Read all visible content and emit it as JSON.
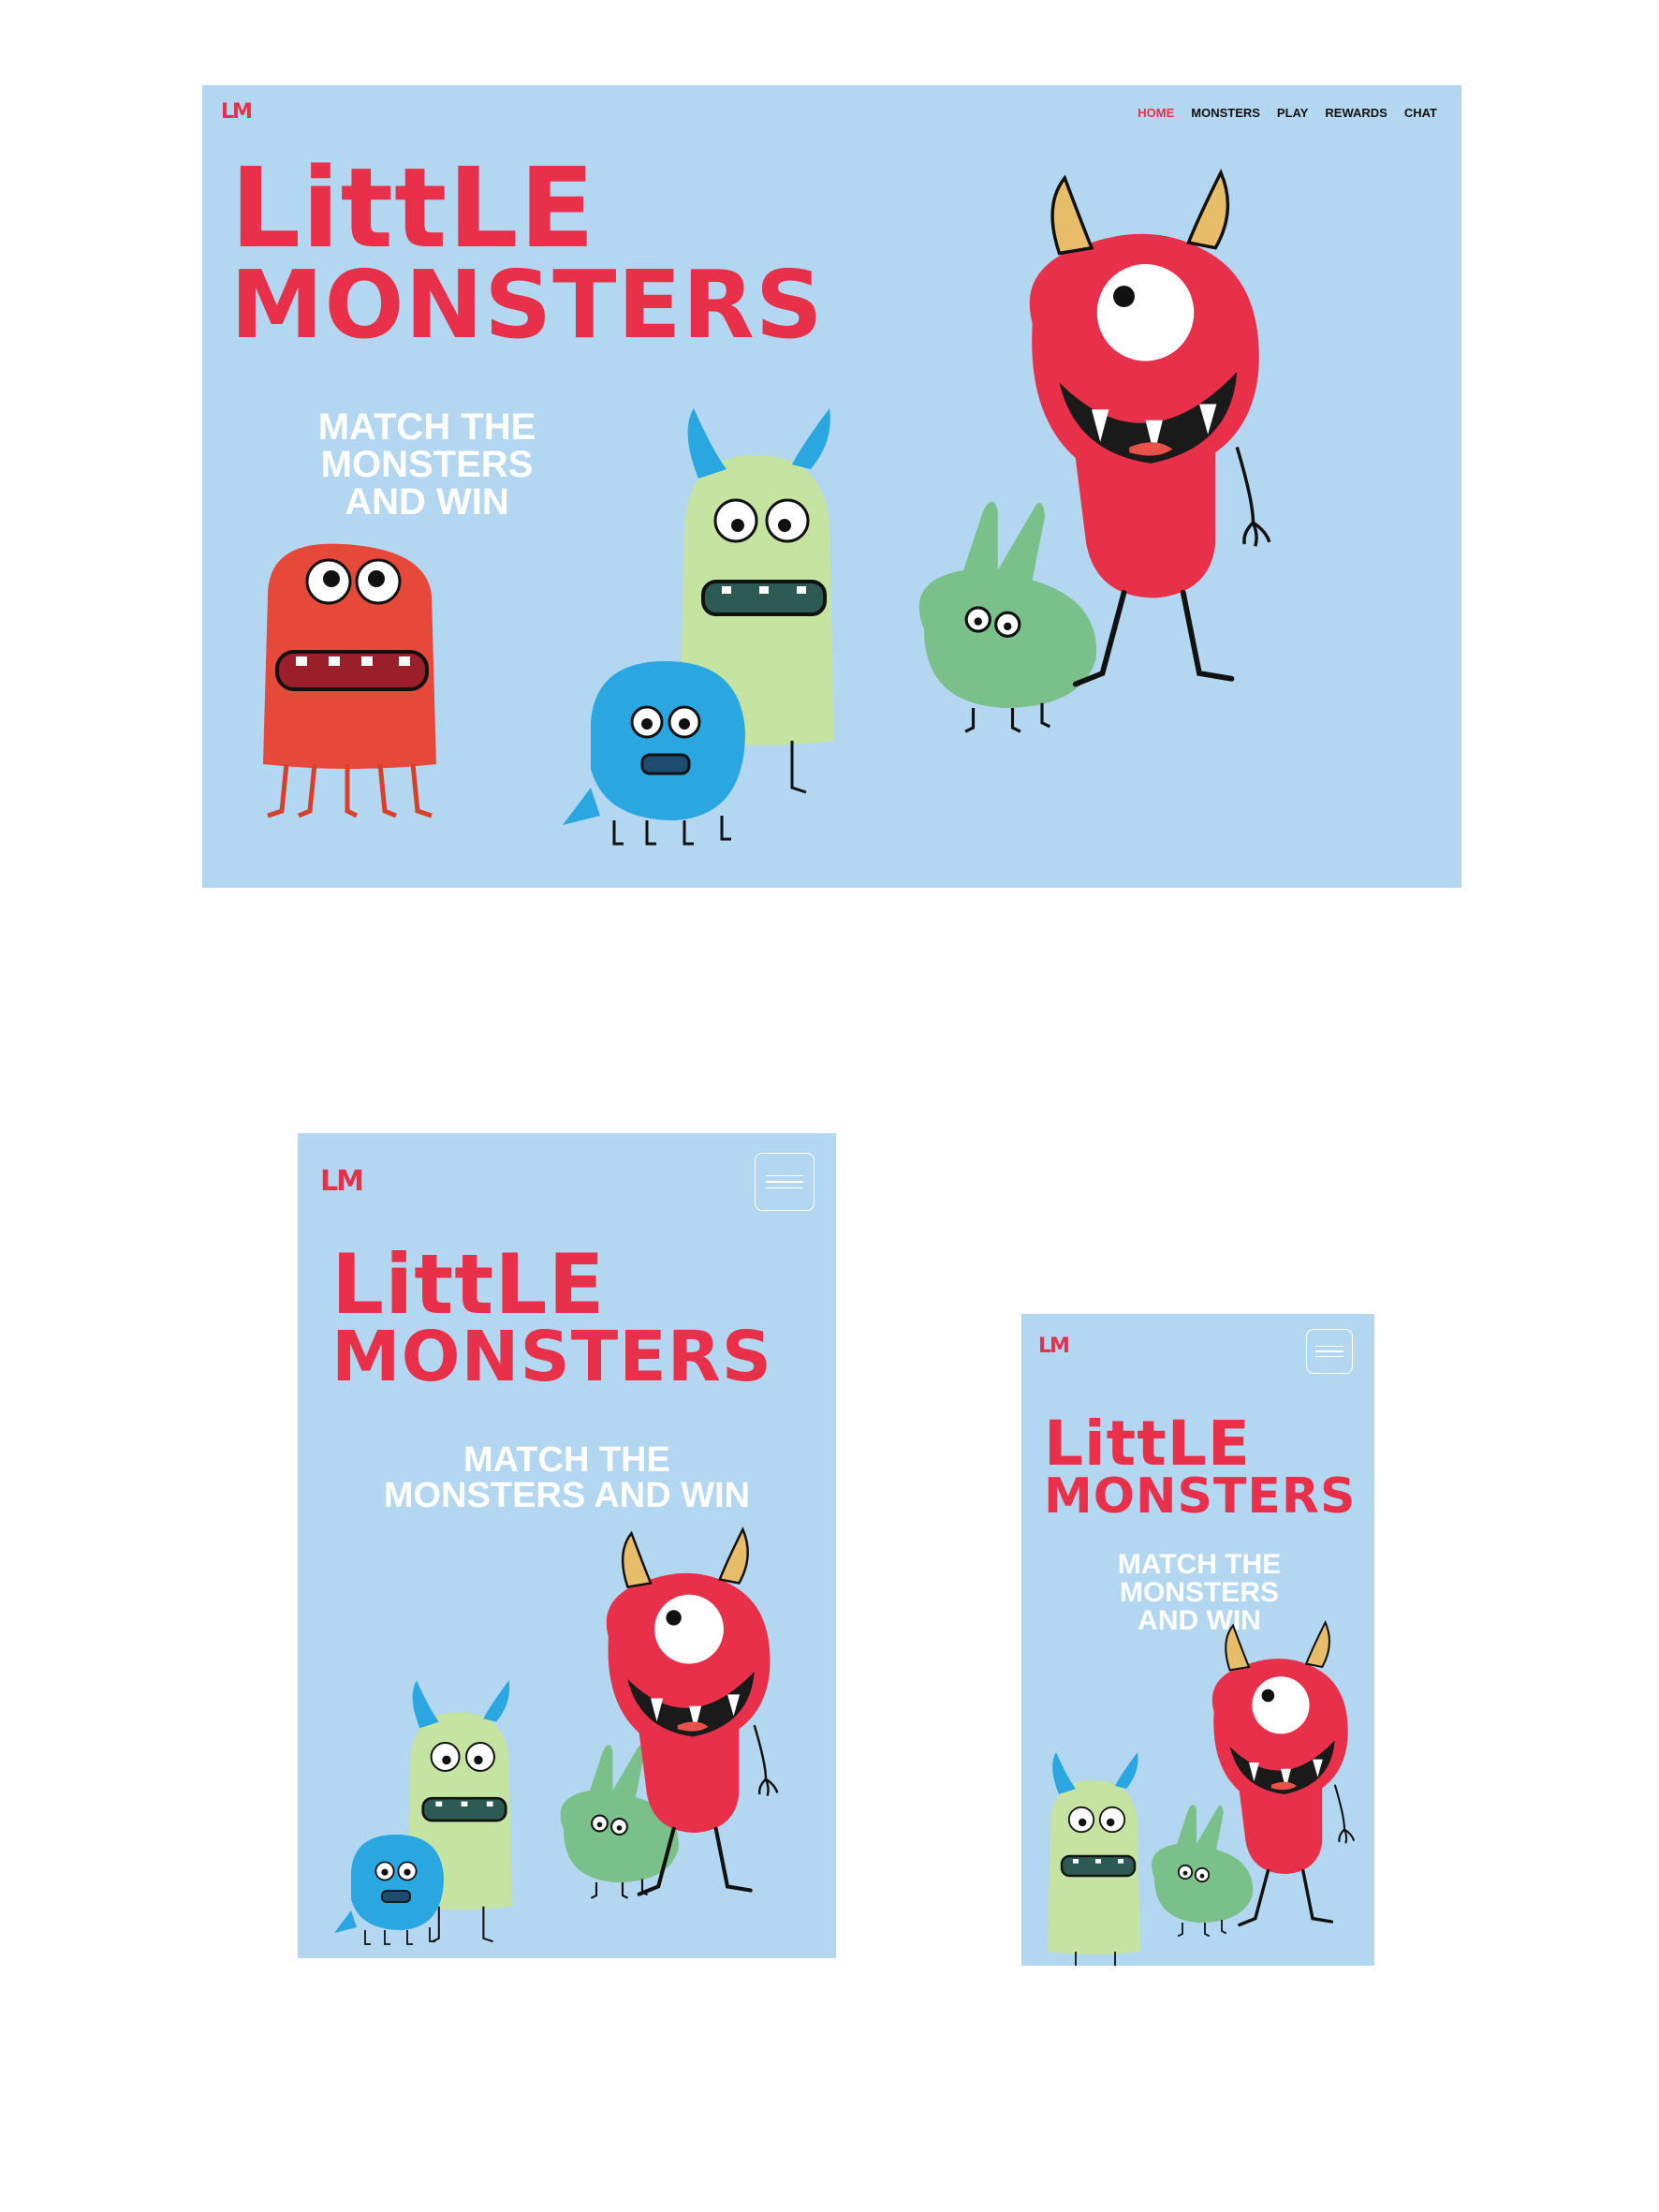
{
  "brand": {
    "logo": "LM",
    "color": "#e8304a",
    "bg": "#b4d7f1"
  },
  "nav": {
    "items": [
      {
        "label": "HOME",
        "active": true
      },
      {
        "label": "MONSTERS",
        "active": false
      },
      {
        "label": "PLAY",
        "active": false
      },
      {
        "label": "REWARDS",
        "active": false
      },
      {
        "label": "CHAT",
        "active": false
      }
    ]
  },
  "hero": {
    "title_line1": "LittLE",
    "title_line2": "MONSTERS",
    "tagline": [
      "MATCH THE",
      "MONSTERS",
      "AND WIN"
    ],
    "tagline_wide": [
      "MATCH THE",
      "MONSTERS AND WIN"
    ]
  },
  "icons": {
    "menu": "hamburger-menu-icon"
  }
}
